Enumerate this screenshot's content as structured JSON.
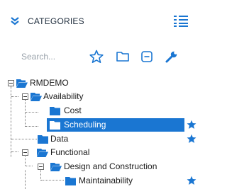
{
  "header": {
    "title": "CATEGORIES",
    "collapse_icon": "double-chevron-down-icon",
    "list_icon": "numbered-list-icon"
  },
  "toolbar": {
    "search_placeholder": "Search...",
    "icons": [
      "star-outline-icon",
      "folder-icon",
      "collapse-minus-icon",
      "wrench-icon"
    ]
  },
  "colors": {
    "accent": "#1a76d2",
    "folder": "#1a76d2",
    "selected_text": "#ffffff"
  },
  "tree": {
    "items": [
      {
        "label": "RMDEMO",
        "expanded": true,
        "starred": false,
        "selected": false
      },
      {
        "label": "Availability",
        "expanded": true,
        "starred": false,
        "selected": false
      },
      {
        "label": "Cost",
        "expanded": false,
        "starred": false,
        "selected": false
      },
      {
        "label": "Scheduling",
        "expanded": false,
        "starred": true,
        "selected": true
      },
      {
        "label": "Data",
        "expanded": false,
        "starred": true,
        "selected": false
      },
      {
        "label": "Functional",
        "expanded": true,
        "starred": false,
        "selected": false
      },
      {
        "label": "Design and Construction",
        "expanded": true,
        "starred": false,
        "selected": false
      },
      {
        "label": "Maintainability",
        "expanded": false,
        "starred": true,
        "selected": false
      }
    ]
  }
}
